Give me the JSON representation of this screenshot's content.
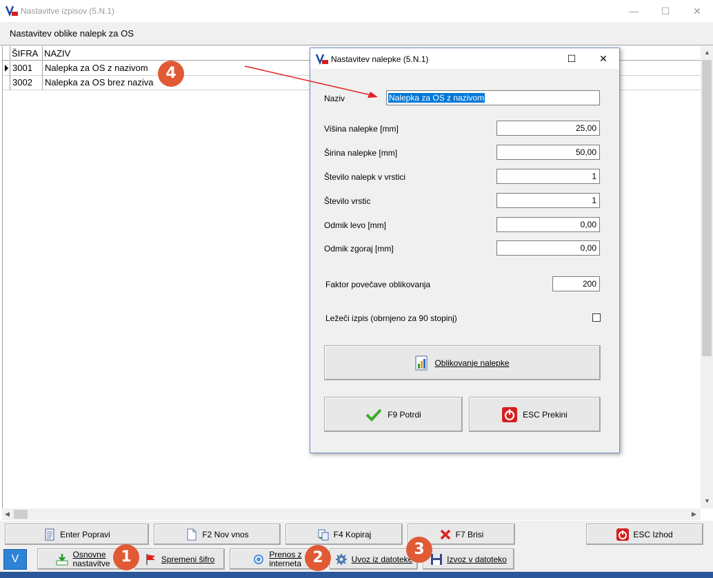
{
  "window": {
    "title": "Nastavitve izpisov  (5.N.1)",
    "subtitle": "Nastavitev oblike nalepk za OS",
    "minimize": "—",
    "maximize": "☐",
    "close": "✕"
  },
  "grid": {
    "columns": [
      "ŠIFRA",
      "NAZIV"
    ],
    "rows": [
      {
        "sifra": "3001",
        "naziv": "Nalepka za OS z nazivom"
      },
      {
        "sifra": "3002",
        "naziv": "Nalepka za OS brez naziva"
      }
    ]
  },
  "toolbar1": {
    "enter": "Enter Popravi",
    "f2": "F2 Nov vnos",
    "f4": "F4 Kopiraj",
    "f7": "F7 Brisi",
    "esc": "ESC Izhod"
  },
  "toolbar2": {
    "v": "V",
    "osnovne1": "Osnovne",
    "osnovne2": "nastavitve",
    "spremeni": "Spremeni šifro",
    "prenos1": "Prenos z",
    "prenos2": "interneta",
    "uvoz": "Uvoz iz datoteke",
    "izvoz": "Izvoz v datoteko"
  },
  "badges": [
    "1",
    "2",
    "3",
    "4"
  ],
  "dialog": {
    "title": "Nastavitev nalepke  (5.N.1)",
    "naziv_label": "Naziv",
    "naziv_value": "Nalepka za OS z nazivom",
    "fields": [
      {
        "label": "Višina nalepke [mm]",
        "value": "25,00"
      },
      {
        "label": "Širina nalepke [mm]",
        "value": "50,00"
      },
      {
        "label": "Število nalepk v vrstici",
        "value": "1"
      },
      {
        "label": "Število vrstic",
        "value": "1"
      },
      {
        "label": "Odmik levo [mm]",
        "value": "0,00"
      },
      {
        "label": "Odmik zgoraj [mm]",
        "value": "0,00"
      }
    ],
    "faktor_label": "Faktor povečave oblikovanja",
    "faktor_value": "200",
    "lezeci_label": "Ležeči izpis (obrnjeno za 90 stopinj)",
    "oblikovanje": "Oblikovanje nalepke",
    "potrdi": "F9 Potrdi",
    "prekini": "ESC Prekini"
  },
  "colors": {
    "accent": "#0078d7",
    "badge": "#e05a35",
    "arrow": "#e02020"
  }
}
